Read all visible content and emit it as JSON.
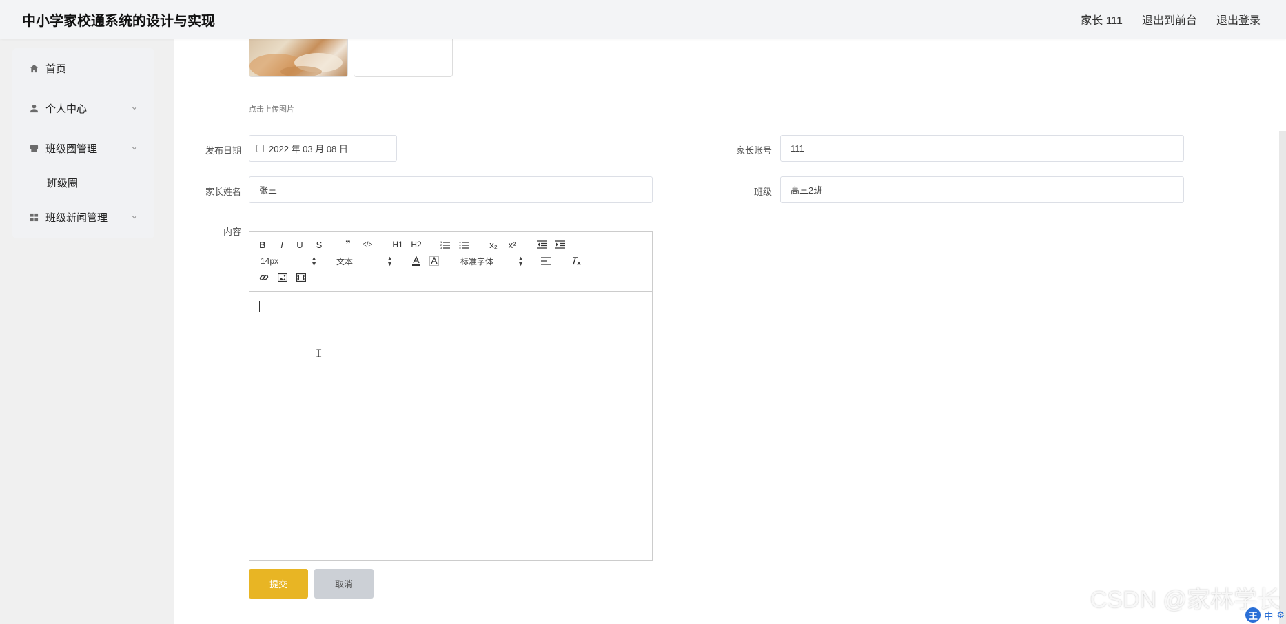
{
  "app": {
    "title": "中小学家校通系统的设计与实现"
  },
  "topbar": {
    "user": "家长 111",
    "exit_front": "退出到前台",
    "logout": "退出登录"
  },
  "sidebar": {
    "items": [
      {
        "label": "首页",
        "icon": "home-icon"
      },
      {
        "label": "个人中心",
        "icon": "user-icon"
      },
      {
        "label": "班级圈管理",
        "icon": "box-icon"
      },
      {
        "label": "班级圈",
        "icon": ""
      },
      {
        "label": "班级新闻管理",
        "icon": "grid-icon"
      }
    ]
  },
  "upload": {
    "hint": "点击上传图片"
  },
  "form": {
    "publish_date_label": "发布日期",
    "publish_date_value": "2022 年 03 月 08 日",
    "parent_account_label": "家长账号",
    "parent_account_value": "111",
    "parent_name_label": "家长姓名",
    "parent_name_value": "张三",
    "class_label": "班级",
    "class_value": "高三2班",
    "content_label": "内容"
  },
  "editor": {
    "row1": [
      "B",
      "I",
      "U",
      "S",
      "❞",
      "</>",
      "H1",
      "H2",
      "ol",
      "ul",
      "x₂",
      "x²",
      "outdent",
      "indent"
    ],
    "font_size": "14px",
    "header_type": "文本",
    "font_family": "标准字体",
    "row3": [
      "link",
      "image",
      "video"
    ]
  },
  "buttons": {
    "submit": "提交",
    "cancel": "取消"
  },
  "watermark": "CSDN @家林学长",
  "ime": {
    "logo": "王",
    "lang": "中"
  },
  "colors": {
    "accent": "#e8b524",
    "cancel": "#ccd0d6",
    "sidebar_bg": "#f1f2f4"
  }
}
